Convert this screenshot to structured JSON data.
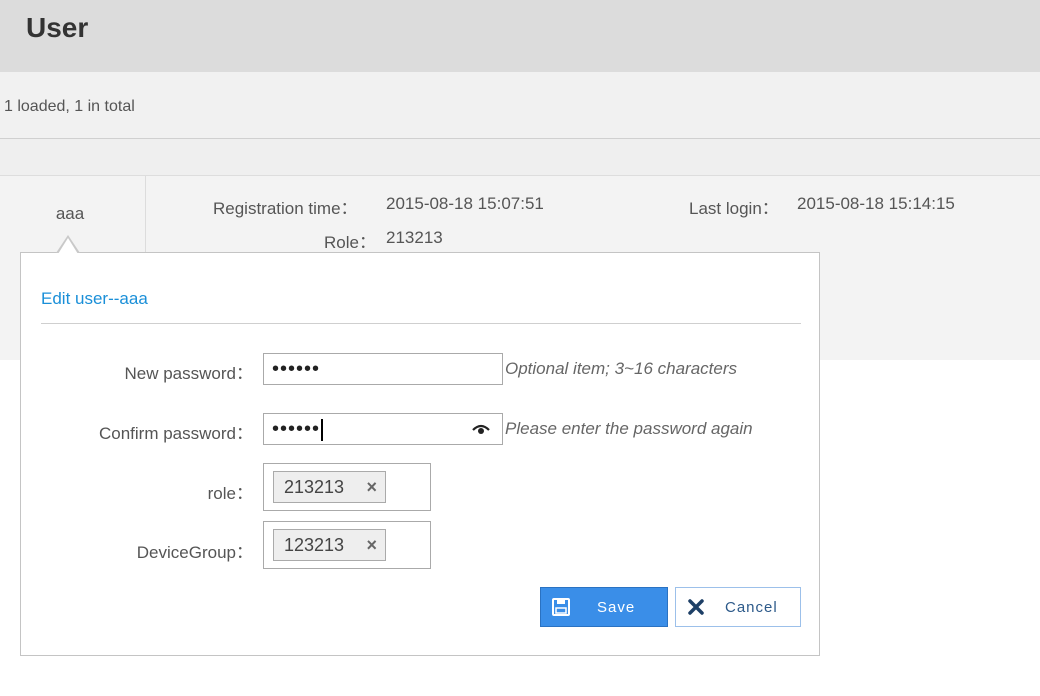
{
  "header": {
    "title": "User"
  },
  "status": {
    "text": "1 loaded, 1 in total"
  },
  "user_row": {
    "username": "aaa",
    "registration_label": "Registration time：",
    "registration_value": "2015-08-18 15:07:51",
    "last_login_label": "Last login：",
    "last_login_value": "2015-08-18 15:14:15",
    "role_label": "Role：",
    "role_value": "213213"
  },
  "dialog": {
    "title": "Edit user--aaa",
    "fields": {
      "new_password": {
        "label": "New password：",
        "value": "••••••",
        "hint": "Optional item; 3~16 characters"
      },
      "confirm_password": {
        "label": "Confirm password：",
        "value": "••••••",
        "hint": "Please enter the password again"
      },
      "role": {
        "label": "role：",
        "tag": "213213"
      },
      "device_group": {
        "label": "DeviceGroup：",
        "tag": "123213"
      }
    },
    "buttons": {
      "save": "Save",
      "cancel": "Cancel"
    },
    "icons": {
      "remove_tag": "×",
      "save_icon": "save-icon",
      "cancel_icon": "close-icon",
      "show_password_icon": "eye-icon"
    }
  },
  "colors": {
    "accent": "#1a8fd8",
    "save_button": "#3a8ee8",
    "header_bg": "#dcdcdc"
  }
}
